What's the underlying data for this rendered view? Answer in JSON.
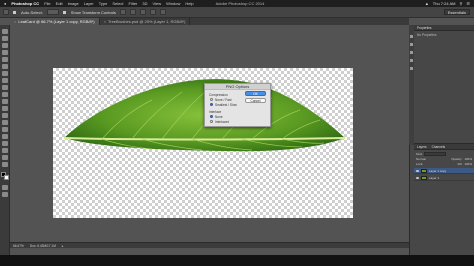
{
  "menubar": {
    "apple": "",
    "app_name": "Photoshop CC",
    "items": [
      "File",
      "Edit",
      "Image",
      "Layer",
      "Type",
      "Select",
      "Filter",
      "3D",
      "View",
      "Window",
      "Help"
    ],
    "window_title": "Adobe Photoshop CC 2014",
    "clock": "Thu 7:24 AM"
  },
  "options_bar": {
    "auto_select": "Auto-Select:",
    "show_transform": "Show Transform Controls",
    "essentials": "Essentials"
  },
  "tabs": [
    {
      "label": "LeafCard @ 66.7% (Layer 1 copy, RGB/8*)",
      "active": true
    },
    {
      "label": "TreeBrushes.psd @ 25% (Layer 1, RGB/8*)",
      "active": false
    }
  ],
  "png_dialog": {
    "title": "PNG Options",
    "compression_label": "Compression",
    "compression_options": [
      "None / Fast",
      "Smallest / Slow"
    ],
    "compression_selected": 1,
    "interlace_label": "Interlace",
    "interlace_options": [
      "None",
      "Interlaced"
    ],
    "interlace_selected": 0,
    "ok_label": "OK",
    "cancel_label": "Cancel"
  },
  "bottom_bar": {
    "zoom": "66.67%",
    "doc_info": "Doc: 6.43M/17.1M"
  },
  "properties_panel": {
    "title": "Properties",
    "subtitle": "No Properties"
  },
  "layers_panel": {
    "tabs": [
      "Layers",
      "Channels"
    ],
    "kind_label": "Kind",
    "mode": "Normal",
    "opacity_label": "Opacity:",
    "opacity": "100%",
    "lock_label": "Lock:",
    "fill_label": "Fill:",
    "fill": "100%",
    "layers": [
      {
        "name": "Layer 1 copy",
        "selected": true
      },
      {
        "name": "Layer 1",
        "selected": false
      }
    ]
  },
  "colors": {
    "leaf_dark": "#2e6a12",
    "leaf_light": "#86c13a",
    "selection_blue": "#3c5a85",
    "dialog_primary": "#4a8fe7"
  }
}
